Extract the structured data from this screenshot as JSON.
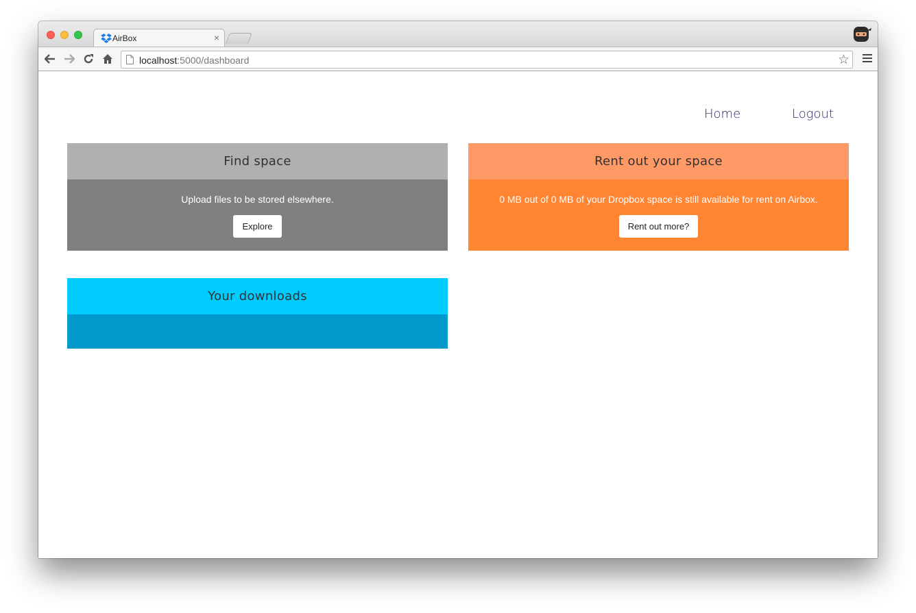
{
  "browser": {
    "tab": {
      "title": "AirBox"
    },
    "address_bar": {
      "host": "localhost",
      "rest": ":5000/dashboard"
    }
  },
  "nav": {
    "home": "Home",
    "logout": "Logout"
  },
  "cards": {
    "find": {
      "title": "Find space",
      "description": "Upload files to be stored elsewhere.",
      "button": "Explore",
      "header_color": "#b0b0b0",
      "body_color": "#808080"
    },
    "rent": {
      "title": "Rent out your space",
      "description": "0 MB out of 0 MB of your Dropbox space is still available for rent on Airbox.",
      "button": "Rent out more?",
      "header_color": "#ff9966",
      "body_color": "#ff8533"
    },
    "downloads": {
      "title": "Your downloads",
      "header_color": "#00ccff",
      "body_color": "#0099cc"
    }
  },
  "colors": {
    "nav_link": "#2a1e66"
  }
}
